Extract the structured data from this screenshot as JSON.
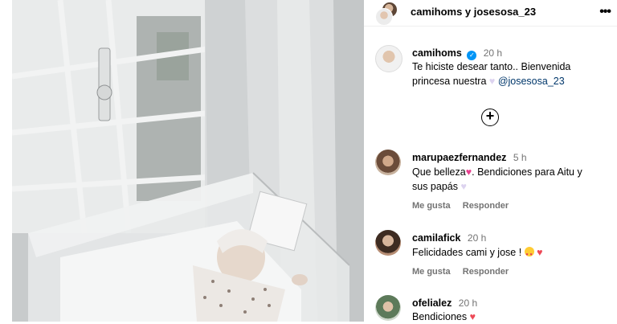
{
  "post": {
    "header_title": "camihoms y josesosa_23",
    "caption": {
      "username": "camihoms",
      "time": "20 h",
      "line1": "Te hiciste desear tanto.. Bienvenida",
      "line2_before": "princesa nuestra",
      "line2_mention": "@josesosa_23"
    },
    "comments": [
      {
        "username": "marupaezfernandez",
        "time": "5 h",
        "line1": "Que belleza",
        "line1b": ". Bendiciones para Aitu y",
        "line2": "sus papás"
      },
      {
        "username": "camilafick",
        "time": "20 h",
        "line1": "Felicidades cami y jose !"
      },
      {
        "username": "ofelialez",
        "time": "20 h",
        "line1": "Bendiciones"
      }
    ],
    "actions": {
      "like": "Me gusta",
      "reply": "Responder"
    }
  },
  "colors": {
    "accent": "#0095f6",
    "heart": "#ed4956",
    "muted": "#737373",
    "mention": "#00376b"
  },
  "icons": [
    "more-icon",
    "verified-icon",
    "add-circle-icon",
    "heart-icon",
    "heart-eyes-icon"
  ]
}
